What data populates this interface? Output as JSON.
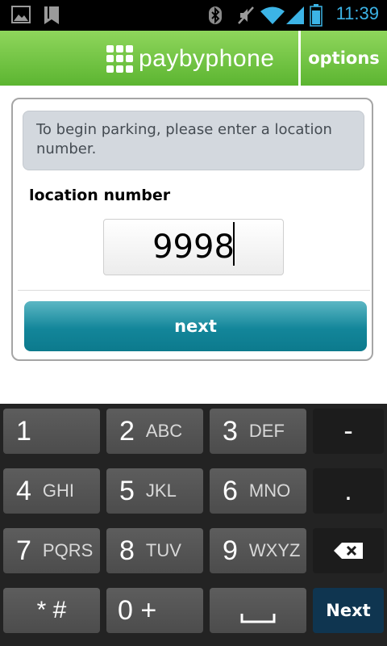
{
  "status_bar": {
    "time": "11:39",
    "icons": [
      "image-icon",
      "sd-card-icon",
      "bluetooth-icon",
      "mute-icon",
      "wifi-icon",
      "signal-icon",
      "battery-icon"
    ]
  },
  "header": {
    "logo_text": "paybyphone",
    "options_label": "options",
    "colors": {
      "header_top": "#8fd65c",
      "header_bottom": "#5cb531"
    }
  },
  "form": {
    "instruction": "To begin parking, please enter a location number.",
    "field_label": "location number",
    "location_value": "9998",
    "next_label": "next",
    "colors": {
      "button": "#13869a"
    }
  },
  "keyboard": {
    "keys": [
      {
        "digit": "1",
        "letters": ""
      },
      {
        "digit": "2",
        "letters": "ABC"
      },
      {
        "digit": "3",
        "letters": "DEF"
      },
      {
        "symbol": "-"
      },
      {
        "digit": "4",
        "letters": "GHI"
      },
      {
        "digit": "5",
        "letters": "JKL"
      },
      {
        "digit": "6",
        "letters": "MNO"
      },
      {
        "symbol": "."
      },
      {
        "digit": "7",
        "letters": "PQRS"
      },
      {
        "digit": "8",
        "letters": "TUV"
      },
      {
        "digit": "9",
        "letters": "WXYZ"
      },
      {
        "icon": "backspace-icon"
      },
      {
        "symbol": "* #"
      },
      {
        "symbol": "0 +"
      },
      {
        "icon": "space-icon"
      },
      {
        "label": "Next"
      }
    ]
  }
}
